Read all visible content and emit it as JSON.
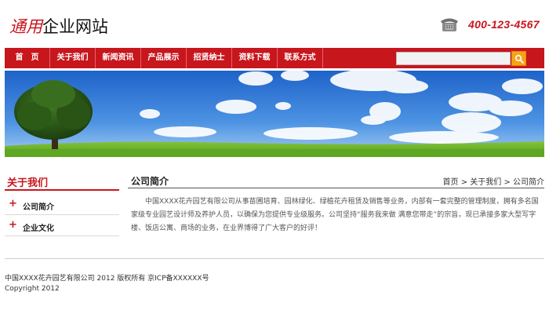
{
  "header": {
    "logo_red": "通用",
    "logo_black": "企业网站",
    "phone": "400-123-4567",
    "phone_icon": "phone-icon"
  },
  "nav": {
    "items": [
      {
        "label": "首　页"
      },
      {
        "label": "关于我们"
      },
      {
        "label": "新闻资讯"
      },
      {
        "label": "产品展示"
      },
      {
        "label": "招贤纳士"
      },
      {
        "label": "资料下载"
      },
      {
        "label": "联系方式"
      }
    ],
    "search_value": "",
    "search_icon": "search-icon"
  },
  "banner": {
    "image": "tree-on-green-field-under-blue-sky"
  },
  "sidebar": {
    "title": "关于我们",
    "items": [
      {
        "label": "公司简介"
      },
      {
        "label": "企业文化"
      }
    ]
  },
  "main": {
    "title": "公司简介",
    "breadcrumb": [
      "首页",
      "关于我们",
      "公司简介"
    ],
    "breadcrumb_sep": " > ",
    "body": "中国XXXX花卉园艺有限公司从事苗圃培育、园林绿化、绿植花卉租赁及销售等业务，内部有一套完整的管理制度，拥有多名国家级专业园艺设计师及养护人员，以确保为您提供专业级服务。公司坚持“服务我来做 满意您带走”的宗旨，现已承接多家大型写字楼、饭店公寓、商场的业务，在业界博得了广大客户的好评！"
  },
  "footer": {
    "line1": "中国XXXX花卉园艺有限公司 2012 版权所有 京ICP备XXXXXX号",
    "line2": "Copyright 2012"
  },
  "colors": {
    "brand_red": "#c8161d",
    "search_orange": "#f7a21b"
  }
}
